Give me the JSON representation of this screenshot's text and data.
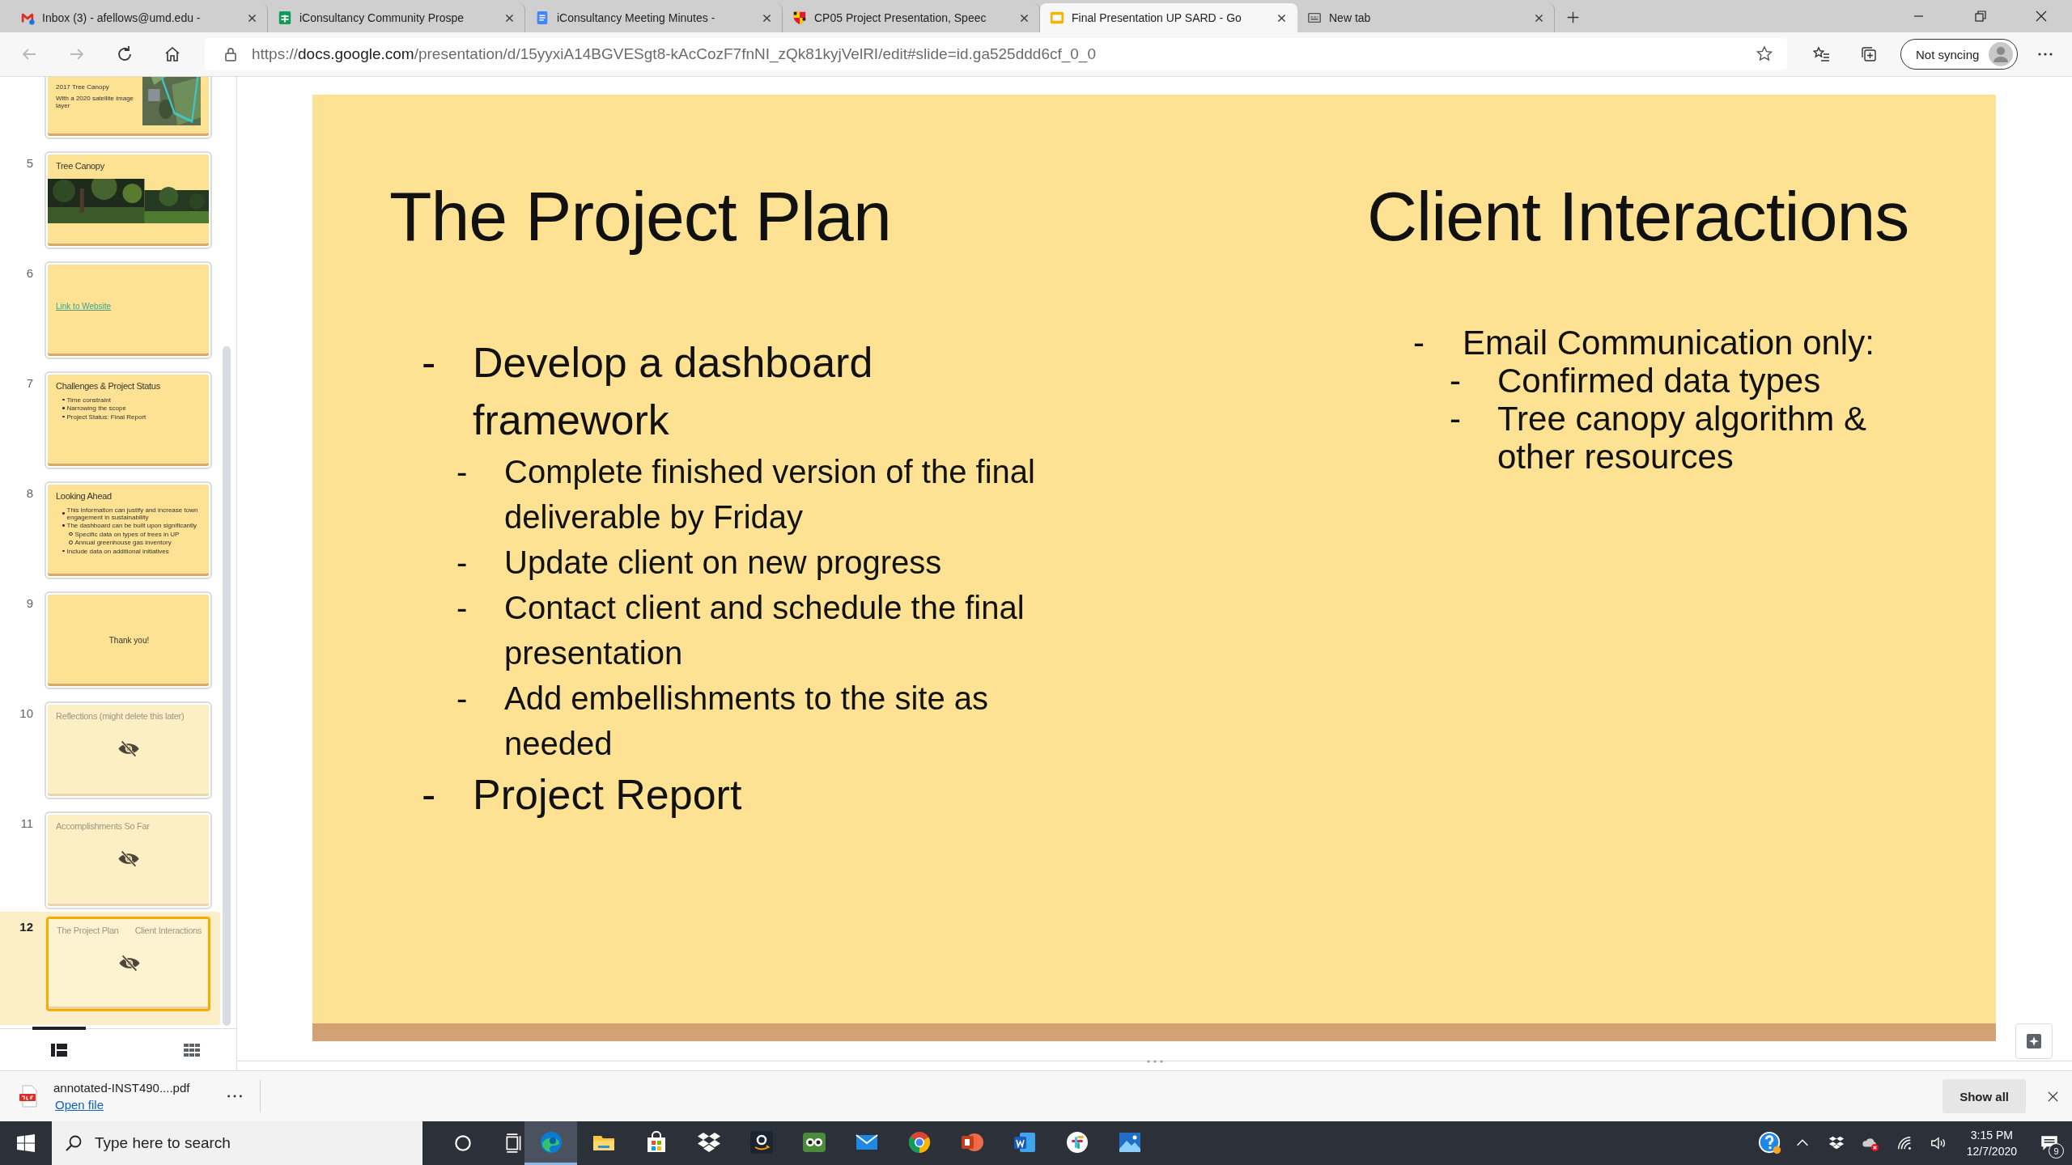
{
  "tabs": [
    {
      "title": "Inbox (3) - afellows@umd.edu -",
      "kind": "mail",
      "selected": false
    },
    {
      "title": "iConsultancy Community Prospe",
      "kind": "sheet",
      "selected": false
    },
    {
      "title": "iConsultancy Meeting Minutes -",
      "kind": "doc",
      "selected": false
    },
    {
      "title": "CP05 Project Presentation, Speec",
      "kind": "shield",
      "selected": false
    },
    {
      "title": "Final Presentation UP SARD - Go",
      "kind": "slides",
      "selected": true
    },
    {
      "title": "New tab",
      "kind": "newtab",
      "selected": false
    }
  ],
  "toolbar": {
    "forward_disabled": true,
    "address": {
      "scheme": "https://",
      "host": "docs.google.com",
      "path": "/presentation/d/15yyxiA14BGVESgt8-kAcCozF7fnNI_zQk81kyjVelRI/edit#slide=id.ga525ddd6cf_0_0"
    },
    "profile_label": "Not syncing"
  },
  "filmstrip": {
    "slides": [
      {
        "selected": false,
        "hidden": false,
        "kind": "text-picture",
        "lines": [
          "2017 Tree Canopy",
          "With a 2020 satellite image layer"
        ]
      },
      {
        "number": "5",
        "selected": false,
        "hidden": false,
        "kind": "title-pictures",
        "title": "Tree Canopy"
      },
      {
        "number": "6",
        "selected": false,
        "hidden": false,
        "kind": "link",
        "link": "Link to Website"
      },
      {
        "number": "7",
        "selected": false,
        "hidden": false,
        "kind": "bullets",
        "title": "Challenges & Project Status",
        "bullets": [
          {
            "text": "Time constraint"
          },
          {
            "text": "Narrowing the scope"
          },
          {
            "text": "Project Status: Final Report"
          }
        ]
      },
      {
        "number": "8",
        "selected": false,
        "hidden": false,
        "kind": "bullets",
        "title": "Looking Ahead",
        "bullets": [
          {
            "text": "This information can justify and increase town engagement in sustainability"
          },
          {
            "text": "The dashboard can be built upon significantly",
            "children": [
              "Specific data on types of trees in UP",
              "Annual greenhouse gas inventory"
            ]
          },
          {
            "text": "Include data on additional initiatives"
          }
        ]
      },
      {
        "number": "9",
        "selected": false,
        "hidden": false,
        "kind": "center",
        "title": "Thank you!"
      },
      {
        "number": "10",
        "selected": false,
        "hidden": true,
        "kind": "bullets",
        "title": "Reflections (might delete this later)"
      },
      {
        "number": "11",
        "selected": false,
        "hidden": true,
        "kind": "bullets",
        "title": "Accomplishments So Far"
      },
      {
        "number": "12",
        "selected": true,
        "hidden": true,
        "kind": "two-column",
        "titles": [
          "The Project Plan",
          "Client Interactions"
        ]
      }
    ],
    "views": [
      {
        "kind": "list",
        "selected": true
      },
      {
        "kind": "grid",
        "selected": false
      }
    ]
  },
  "slide": {
    "columns": [
      {
        "title": "The Project Plan",
        "items": [
          {
            "marker": "-",
            "text": "Develop a dashboard framework",
            "children": [
              {
                "marker": "-",
                "text": "Complete finished version of the final deliverable by Friday"
              },
              {
                "marker": "-",
                "text": "Update client on new progress"
              },
              {
                "marker": "-",
                "text": "Contact client and schedule the final presentation"
              },
              {
                "marker": "-",
                "text": "Add embellishments to the site as needed"
              }
            ]
          },
          {
            "marker": "-",
            "text": "Project Report"
          }
        ]
      },
      {
        "title": "Client Interactions",
        "items": [
          {
            "marker": "-",
            "text": "Email Communication only:",
            "children": [
              {
                "marker": "-",
                "text": "Confirmed data types"
              },
              {
                "marker": "-",
                "text": "Tree canopy algorithm & other resources"
              }
            ]
          }
        ]
      }
    ]
  },
  "download_bar": {
    "file": "annotated-INST490....pdf",
    "link": "Open file",
    "show_all": "Show all"
  },
  "taskbar": {
    "search_placeholder": "Type here to search",
    "apps": [
      {
        "kind": "edge",
        "active": true
      },
      {
        "kind": "folder",
        "active": false
      },
      {
        "kind": "store",
        "active": false
      },
      {
        "kind": "dropbox",
        "active": false
      },
      {
        "kind": "amazon",
        "active": false
      },
      {
        "kind": "owl",
        "active": false
      },
      {
        "kind": "mail",
        "active": false
      },
      {
        "kind": "chrome",
        "active": false
      },
      {
        "kind": "powerpoint",
        "active": false
      },
      {
        "kind": "word",
        "active": false
      },
      {
        "kind": "slack",
        "active": false
      },
      {
        "kind": "photos",
        "active": false
      }
    ],
    "time": "3:15 PM",
    "date": "12/7/2020",
    "notifications": "9"
  }
}
